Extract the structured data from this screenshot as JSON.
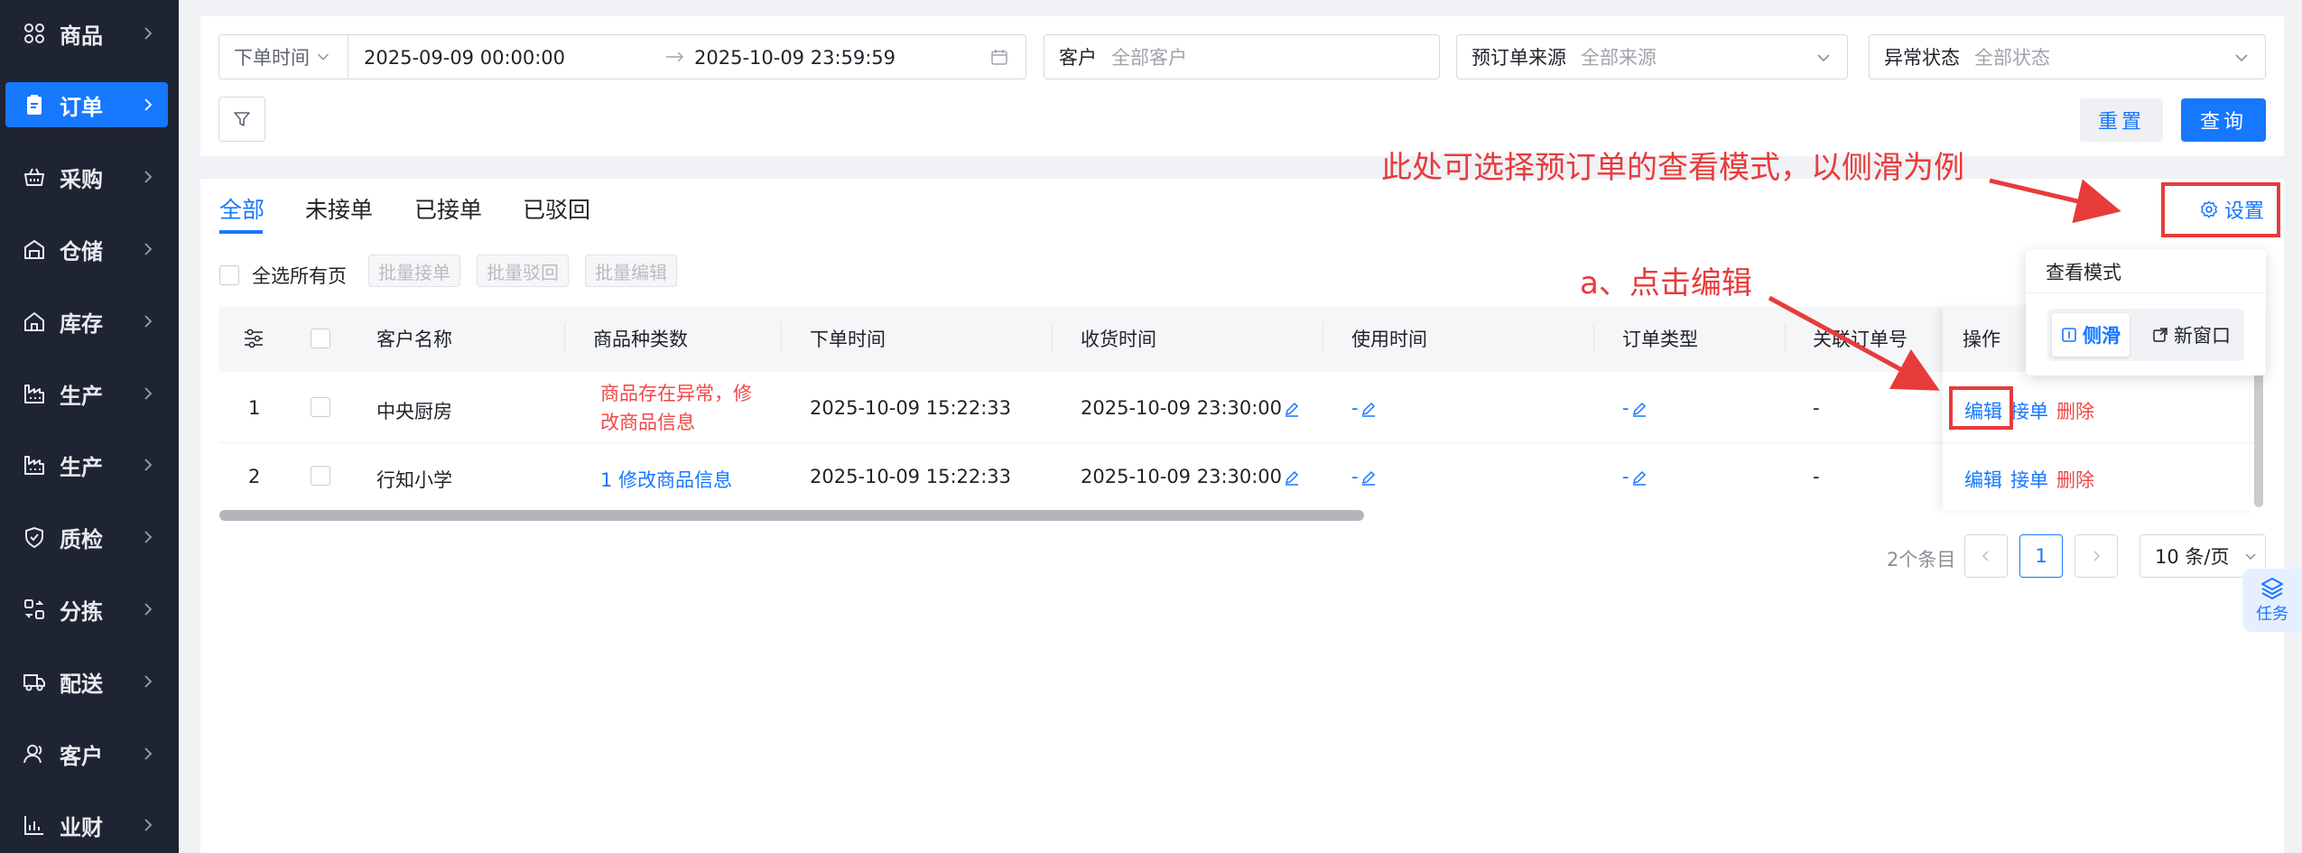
{
  "sidebar": {
    "items": [
      {
        "label": "商品",
        "icon": "grid-icon",
        "active": false
      },
      {
        "label": "订单",
        "icon": "clipboard-icon",
        "active": true
      },
      {
        "label": "采购",
        "icon": "basket-icon",
        "active": false
      },
      {
        "label": "仓储",
        "icon": "warehouse-icon",
        "active": false
      },
      {
        "label": "库存",
        "icon": "house-icon",
        "active": false
      },
      {
        "label": "生产",
        "icon": "factory-icon",
        "active": false
      },
      {
        "label": "生产",
        "icon": "factory-icon",
        "active": false
      },
      {
        "label": "质检",
        "icon": "shield-icon",
        "active": false
      },
      {
        "label": "分拣",
        "icon": "sort-icon",
        "active": false
      },
      {
        "label": "配送",
        "icon": "truck-icon",
        "active": false
      },
      {
        "label": "客户",
        "icon": "user-icon",
        "active": false
      },
      {
        "label": "业财",
        "icon": "chart-icon",
        "active": false
      }
    ]
  },
  "filters": {
    "date_type": "下单时间",
    "date_start": "2025-09-09 00:00:00",
    "date_end": "2025-10-09 23:59:59",
    "customer_label": "客户",
    "customer_placeholder": "全部客户",
    "source_label": "预订单来源",
    "source_placeholder": "全部来源",
    "abnormal_label": "异常状态",
    "abnormal_placeholder": "全部状态",
    "reset_label": "重置",
    "query_label": "查询"
  },
  "tabs": [
    "全部",
    "未接单",
    "已接单",
    "已驳回"
  ],
  "settings_label": "设置",
  "toolbar": {
    "select_all_label": "全选所有页",
    "batch_accept": "批量接单",
    "batch_reject": "批量驳回",
    "batch_edit": "批量编辑"
  },
  "table": {
    "headers": [
      "客户名称",
      "商品种类数",
      "下单时间",
      "收货时间",
      "使用时间",
      "订单类型",
      "关联订单号",
      "操作"
    ],
    "rows": [
      {
        "index": "1",
        "customer": "中央厨房",
        "goods": "商品存在异常，修改商品信息",
        "goods_line1": "商品存在异常，修",
        "goods_line2": "改商品信息",
        "goods_abnormal": true,
        "order_time": "2025-10-09 15:22:33",
        "receive_time": "2025-10-09 23:30:00",
        "use_time": "-",
        "order_type": "-",
        "related": "-"
      },
      {
        "index": "2",
        "customer": "行知小学",
        "goods": "1 修改商品信息",
        "goods_abnormal": false,
        "order_time": "2025-10-09 15:22:33",
        "receive_time": "2025-10-09 23:30:00",
        "use_time": "-",
        "order_type": "-",
        "related": "-"
      }
    ],
    "actions": {
      "edit": "编辑",
      "accept": "接单",
      "delete": "删除"
    }
  },
  "pagination": {
    "total": "2个条目",
    "current": "1",
    "page_size": "10 条/页"
  },
  "view_mode_popup": {
    "title": "查看模式",
    "options": [
      {
        "label": "侧滑",
        "selected": true
      },
      {
        "label": "新窗口",
        "selected": false
      }
    ]
  },
  "annotations": {
    "top_note": "此处可选择预订单的查看模式，以侧滑为例",
    "edit_note": "a、点击编辑"
  },
  "task_float_label": "任务",
  "colors": {
    "primary": "#1677ff",
    "sidebar_bg": "#1e2432",
    "annotation_red": "#e83b3b",
    "warning_red": "#f04848"
  }
}
